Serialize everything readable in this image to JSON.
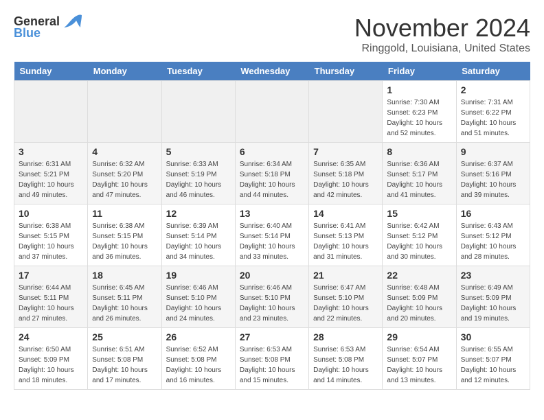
{
  "header": {
    "logo_general": "General",
    "logo_blue": "Blue",
    "month_title": "November 2024",
    "location": "Ringgold, Louisiana, United States"
  },
  "weekdays": [
    "Sunday",
    "Monday",
    "Tuesday",
    "Wednesday",
    "Thursday",
    "Friday",
    "Saturday"
  ],
  "weeks": [
    [
      {
        "day": "",
        "empty": true
      },
      {
        "day": "",
        "empty": true
      },
      {
        "day": "",
        "empty": true
      },
      {
        "day": "",
        "empty": true
      },
      {
        "day": "",
        "empty": true
      },
      {
        "day": "1",
        "sunrise": "7:30 AM",
        "sunset": "6:23 PM",
        "daylight": "10 hours and 52 minutes."
      },
      {
        "day": "2",
        "sunrise": "7:31 AM",
        "sunset": "6:22 PM",
        "daylight": "10 hours and 51 minutes."
      }
    ],
    [
      {
        "day": "3",
        "sunrise": "6:31 AM",
        "sunset": "5:21 PM",
        "daylight": "10 hours and 49 minutes."
      },
      {
        "day": "4",
        "sunrise": "6:32 AM",
        "sunset": "5:20 PM",
        "daylight": "10 hours and 47 minutes."
      },
      {
        "day": "5",
        "sunrise": "6:33 AM",
        "sunset": "5:19 PM",
        "daylight": "10 hours and 46 minutes."
      },
      {
        "day": "6",
        "sunrise": "6:34 AM",
        "sunset": "5:18 PM",
        "daylight": "10 hours and 44 minutes."
      },
      {
        "day": "7",
        "sunrise": "6:35 AM",
        "sunset": "5:18 PM",
        "daylight": "10 hours and 42 minutes."
      },
      {
        "day": "8",
        "sunrise": "6:36 AM",
        "sunset": "5:17 PM",
        "daylight": "10 hours and 41 minutes."
      },
      {
        "day": "9",
        "sunrise": "6:37 AM",
        "sunset": "5:16 PM",
        "daylight": "10 hours and 39 minutes."
      }
    ],
    [
      {
        "day": "10",
        "sunrise": "6:38 AM",
        "sunset": "5:15 PM",
        "daylight": "10 hours and 37 minutes."
      },
      {
        "day": "11",
        "sunrise": "6:38 AM",
        "sunset": "5:15 PM",
        "daylight": "10 hours and 36 minutes."
      },
      {
        "day": "12",
        "sunrise": "6:39 AM",
        "sunset": "5:14 PM",
        "daylight": "10 hours and 34 minutes."
      },
      {
        "day": "13",
        "sunrise": "6:40 AM",
        "sunset": "5:14 PM",
        "daylight": "10 hours and 33 minutes."
      },
      {
        "day": "14",
        "sunrise": "6:41 AM",
        "sunset": "5:13 PM",
        "daylight": "10 hours and 31 minutes."
      },
      {
        "day": "15",
        "sunrise": "6:42 AM",
        "sunset": "5:12 PM",
        "daylight": "10 hours and 30 minutes."
      },
      {
        "day": "16",
        "sunrise": "6:43 AM",
        "sunset": "5:12 PM",
        "daylight": "10 hours and 28 minutes."
      }
    ],
    [
      {
        "day": "17",
        "sunrise": "6:44 AM",
        "sunset": "5:11 PM",
        "daylight": "10 hours and 27 minutes."
      },
      {
        "day": "18",
        "sunrise": "6:45 AM",
        "sunset": "5:11 PM",
        "daylight": "10 hours and 26 minutes."
      },
      {
        "day": "19",
        "sunrise": "6:46 AM",
        "sunset": "5:10 PM",
        "daylight": "10 hours and 24 minutes."
      },
      {
        "day": "20",
        "sunrise": "6:46 AM",
        "sunset": "5:10 PM",
        "daylight": "10 hours and 23 minutes."
      },
      {
        "day": "21",
        "sunrise": "6:47 AM",
        "sunset": "5:10 PM",
        "daylight": "10 hours and 22 minutes."
      },
      {
        "day": "22",
        "sunrise": "6:48 AM",
        "sunset": "5:09 PM",
        "daylight": "10 hours and 20 minutes."
      },
      {
        "day": "23",
        "sunrise": "6:49 AM",
        "sunset": "5:09 PM",
        "daylight": "10 hours and 19 minutes."
      }
    ],
    [
      {
        "day": "24",
        "sunrise": "6:50 AM",
        "sunset": "5:09 PM",
        "daylight": "10 hours and 18 minutes."
      },
      {
        "day": "25",
        "sunrise": "6:51 AM",
        "sunset": "5:08 PM",
        "daylight": "10 hours and 17 minutes."
      },
      {
        "day": "26",
        "sunrise": "6:52 AM",
        "sunset": "5:08 PM",
        "daylight": "10 hours and 16 minutes."
      },
      {
        "day": "27",
        "sunrise": "6:53 AM",
        "sunset": "5:08 PM",
        "daylight": "10 hours and 15 minutes."
      },
      {
        "day": "28",
        "sunrise": "6:53 AM",
        "sunset": "5:08 PM",
        "daylight": "10 hours and 14 minutes."
      },
      {
        "day": "29",
        "sunrise": "6:54 AM",
        "sunset": "5:07 PM",
        "daylight": "10 hours and 13 minutes."
      },
      {
        "day": "30",
        "sunrise": "6:55 AM",
        "sunset": "5:07 PM",
        "daylight": "10 hours and 12 minutes."
      }
    ]
  ],
  "labels": {
    "sunrise_prefix": "Sunrise: ",
    "sunset_prefix": "Sunset: ",
    "daylight_prefix": "Daylight: "
  }
}
